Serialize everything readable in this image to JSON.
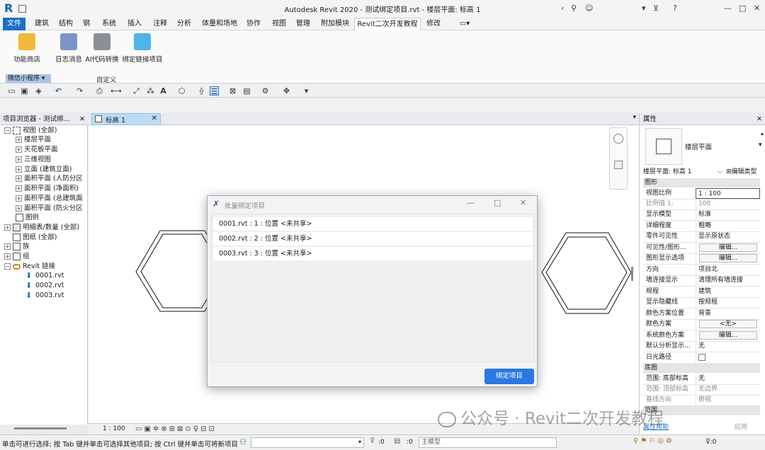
{
  "window": {
    "title": "Autodesk Revit 2020 - 测试绑定项目.rvt - 楼层平面: 标高 1"
  },
  "ribbon": {
    "tabs": [
      "文件",
      "建筑",
      "结构",
      "钢",
      "系统",
      "插入",
      "注释",
      "分析",
      "体量和场地",
      "协作",
      "视图",
      "管理",
      "附加模块",
      "Revit二次开发教程",
      "修改"
    ],
    "active_tab": "Revit二次开发教程",
    "buttons": [
      {
        "label": "功能商店",
        "icon": "gift-icon"
      },
      {
        "label": "日志消息",
        "icon": "log-icon"
      },
      {
        "label": "AI代码转换",
        "icon": "code-icon"
      },
      {
        "label": "绑定链接项目",
        "icon": "link-cubes-icon"
      }
    ],
    "panel_title": "微信小程序 ▾",
    "panel_label": "自定义"
  },
  "browser": {
    "title": "项目浏览器 - 测试绑...",
    "items": [
      {
        "label": "视图 (全部)",
        "exp": "−"
      },
      {
        "label": "楼层平面",
        "exp": "+"
      },
      {
        "label": "天花板平面",
        "exp": "+"
      },
      {
        "label": "三维视图",
        "exp": "+"
      },
      {
        "label": "立面 (建筑立面)",
        "exp": "+"
      },
      {
        "label": "面积平面 (人防分区",
        "exp": "+"
      },
      {
        "label": "面积平面 (净面积)",
        "exp": "+"
      },
      {
        "label": "面积平面 (总建筑面",
        "exp": "+"
      },
      {
        "label": "面积平面 (防火分区",
        "exp": "+"
      },
      {
        "label": "图例",
        "exp": ""
      },
      {
        "label": "明细表/数量 (全部)",
        "exp": "+"
      },
      {
        "label": "图纸 (全部)",
        "exp": ""
      },
      {
        "label": "族",
        "exp": "+"
      },
      {
        "label": "组",
        "exp": "+"
      },
      {
        "label": "Revit 链接",
        "exp": "−"
      },
      {
        "label": "0001.rvt",
        "exp": ""
      },
      {
        "label": "0002.rvt",
        "exp": ""
      },
      {
        "label": "0003.rvt",
        "exp": ""
      }
    ]
  },
  "view": {
    "tab_label": "标高 1",
    "scale": "1 : 100"
  },
  "properties": {
    "title": "属性",
    "type_name": "楼层平面",
    "instance": "楼层平面: 标高 1",
    "edit_type": "编辑类型",
    "sections": [
      {
        "title": "图形"
      },
      {
        "title": "底图"
      },
      {
        "title": "范围"
      }
    ],
    "rows": [
      {
        "k": "视图比例",
        "v": "1 : 100"
      },
      {
        "k": "比例值 1:",
        "v": "100"
      },
      {
        "k": "显示模型",
        "v": "标准"
      },
      {
        "k": "详细程度",
        "v": "粗略"
      },
      {
        "k": "零件可见性",
        "v": "显示原状态"
      },
      {
        "k": "可见性/图形...",
        "v": "编辑..."
      },
      {
        "k": "图形显示选项",
        "v": "编辑..."
      },
      {
        "k": "方向",
        "v": "项目北"
      },
      {
        "k": "墙连接显示",
        "v": "清理所有墙连接"
      },
      {
        "k": "规程",
        "v": "建筑"
      },
      {
        "k": "显示隐藏线",
        "v": "按规程"
      },
      {
        "k": "颜色方案位置",
        "v": "背景"
      },
      {
        "k": "颜色方案",
        "v": "<无>"
      },
      {
        "k": "系统颜色方案",
        "v": "编辑..."
      },
      {
        "k": "默认分析显示...",
        "v": "无"
      },
      {
        "k": "日光路径",
        "v": ""
      },
      {
        "k": "范围: 底部标高",
        "v": "无"
      },
      {
        "k": "范围: 顶部标高",
        "v": "无边界"
      },
      {
        "k": "基线方向",
        "v": "俯视"
      }
    ],
    "help": "属性帮助",
    "apply": "应用"
  },
  "dialog": {
    "title": "批量绑定项目",
    "items": [
      "0001.rvt : 1 : 位置 <未共享>",
      "0002.rvt : 2 : 位置 <未共享>",
      "0003.rvt : 3 : 位置 <未共享>"
    ],
    "bind_button": "绑定项目"
  },
  "status": {
    "text": "单击可进行选择; 按 Tab 键并单击可选择其他项目; 按 Ctrl 键并单击可将新项目",
    "counter": ":0",
    "model": "主模型"
  },
  "watermark": "公众号 · Revit二次开发教程",
  "colors": {
    "accent": "#2a78e4",
    "file_tab": "#1d6fc4",
    "view_tab": "#bcdcf5"
  }
}
